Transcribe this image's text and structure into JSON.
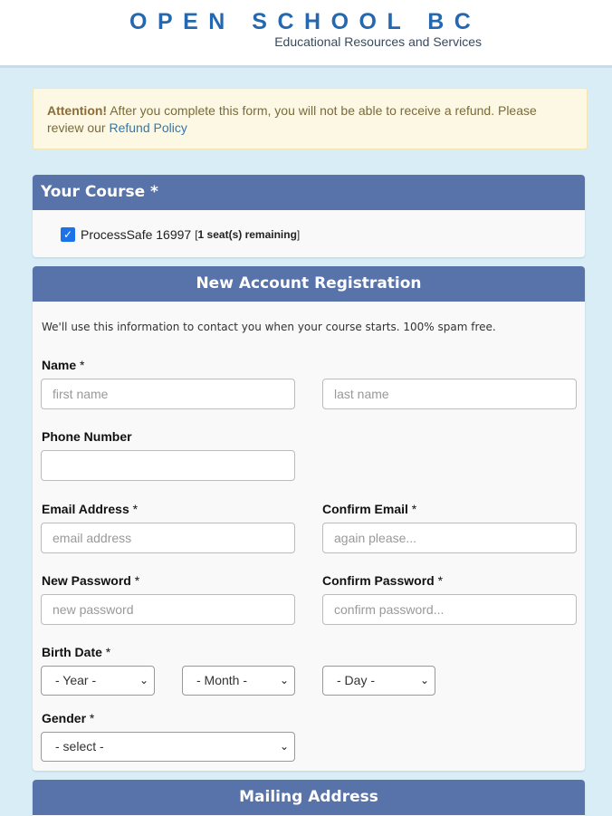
{
  "header": {
    "logo_title": "OPEN SCHOOL BC",
    "logo_subtitle": "Educational Resources and Services"
  },
  "alert": {
    "strong": "Attention!",
    "text": " After you complete this form, you will not be able to receive a refund. Please review our ",
    "link": "Refund Policy"
  },
  "course_panel": {
    "title": "Your Course *",
    "course_name": "ProcessSafe 16997",
    "seats_open": "[",
    "seats_text": "1 seat(s) remaining",
    "seats_close": "]",
    "checked": true
  },
  "registration": {
    "title": "New Account Registration",
    "intro": "We'll use this information to contact you when your course starts. 100% spam free.",
    "name_label": "Name",
    "first_name_placeholder": "first name",
    "last_name_placeholder": "last name",
    "phone_label": "Phone Number",
    "email_label": "Email Address",
    "email_placeholder": "email address",
    "confirm_email_label": "Confirm Email",
    "confirm_email_placeholder": "again please...",
    "password_label": "New Password",
    "password_placeholder": "new password",
    "confirm_password_label": "Confirm Password",
    "confirm_password_placeholder": "confirm password...",
    "birth_label": "Birth Date",
    "year_select": "- Year -",
    "month_select": "- Month -",
    "day_select": "- Day -",
    "gender_label": "Gender",
    "gender_select": "- select -",
    "required_mark": "*"
  },
  "mailing_panel": {
    "title": "Mailing Address"
  },
  "colors": {
    "panel_header": "#5873a9",
    "background": "#d9edf7",
    "logo": "#2568b0",
    "alert_bg": "#fcf8e3"
  }
}
